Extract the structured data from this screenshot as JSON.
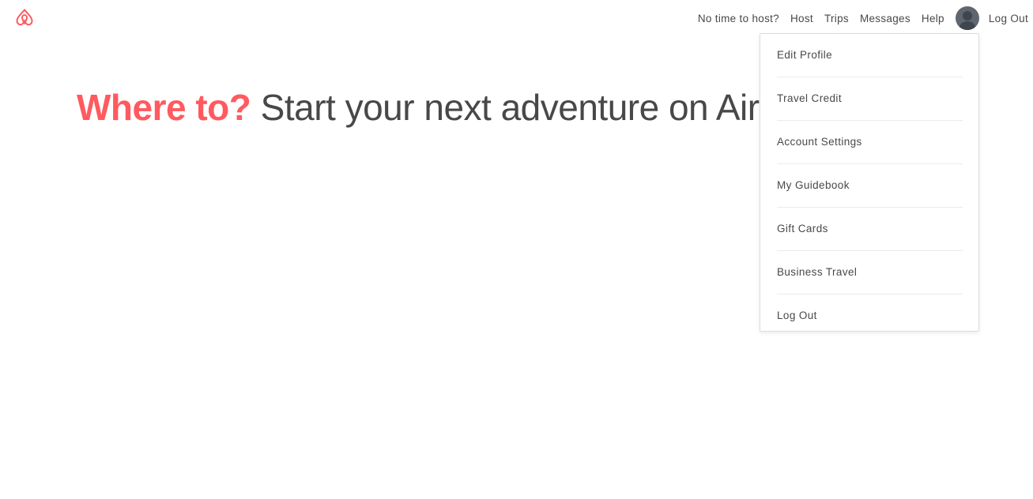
{
  "brand": {
    "logo_icon": "airbnb-belo-icon",
    "accent_color": "#ff5a5f"
  },
  "topnav": {
    "items": [
      {
        "label": "No time to host?"
      },
      {
        "label": "Host"
      },
      {
        "label": "Trips"
      },
      {
        "label": "Messages"
      },
      {
        "label": "Help"
      }
    ],
    "avatar_icon": "user-avatar-icon",
    "logout_label": "Log Out"
  },
  "hero": {
    "accent_text": "Where to?",
    "rest_text": " Start your next adventure on Airbnb"
  },
  "profile_menu": {
    "items": [
      {
        "label": "Edit Profile"
      },
      {
        "label": "Travel Credit"
      },
      {
        "label": "Account Settings"
      },
      {
        "label": "My Guidebook"
      },
      {
        "label": "Gift Cards"
      },
      {
        "label": "Business Travel"
      },
      {
        "label": "Log Out"
      }
    ]
  }
}
